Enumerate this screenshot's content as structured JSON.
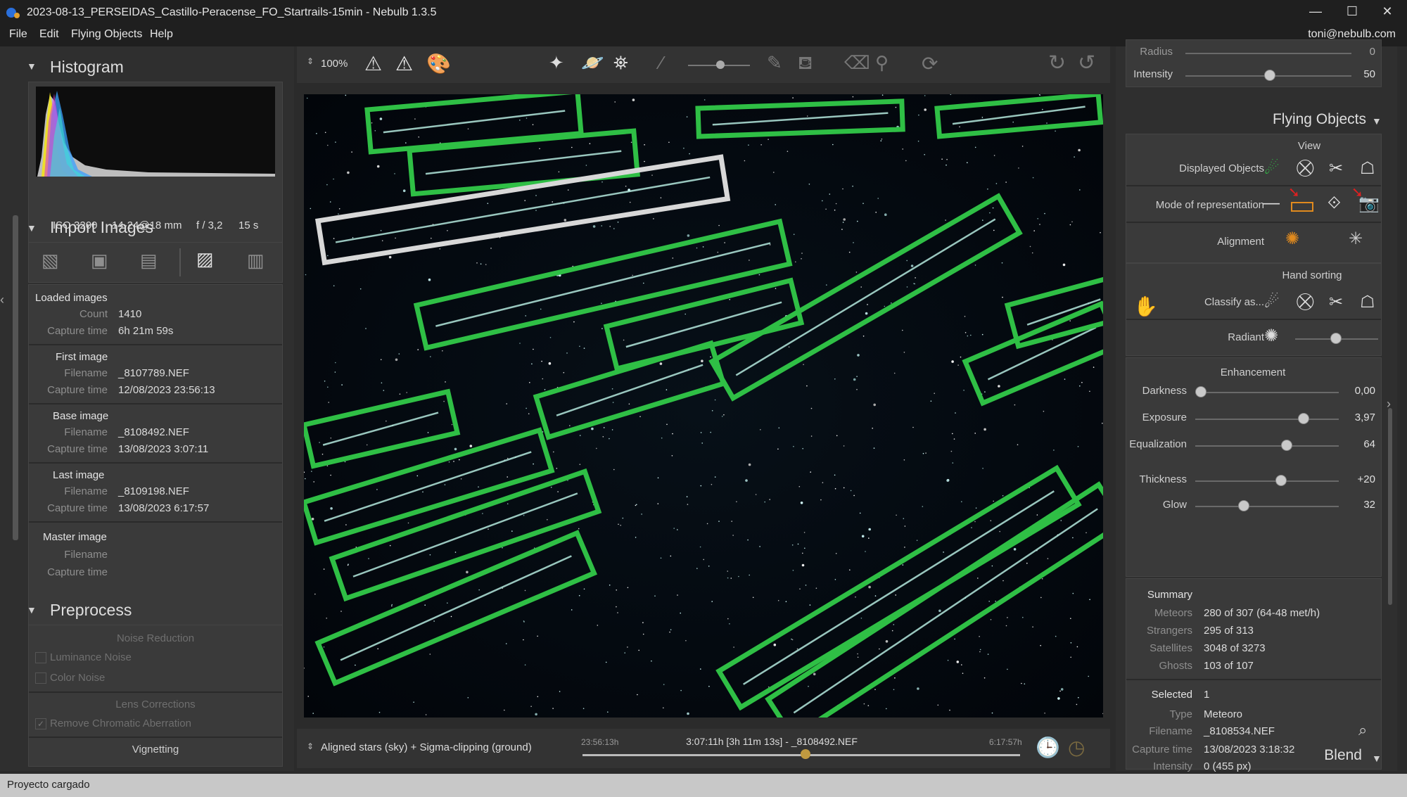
{
  "window": {
    "title": "2023-08-13_PERSEIDAS_Castillo-Peracense_FO_Startrails-15min - Nebulb 1.3.5",
    "min": "—",
    "max": "☐",
    "close": "✕"
  },
  "menu": {
    "file": "File",
    "edit": "Edit",
    "flying_objects": "Flying Objects",
    "help": "Help",
    "user": "toni@nebulb.com"
  },
  "histogram": {
    "header": "Histogram",
    "iso": "ISO 3200",
    "lens": "14-24@18 mm",
    "aperture": "f / 3,2",
    "exposure": "15 s"
  },
  "import": {
    "header": "Import Images",
    "loaded": {
      "title": "Loaded images",
      "count_label": "Count",
      "count": "1410",
      "capture_label": "Capture time",
      "capture": "6h 21m 59s"
    },
    "first": {
      "title": "First image",
      "filename_label": "Filename",
      "filename": "_8107789.NEF",
      "capture_label": "Capture time",
      "capture": "12/08/2023 23:56:13"
    },
    "base": {
      "title": "Base image",
      "filename_label": "Filename",
      "filename": "_8108492.NEF",
      "capture_label": "Capture time",
      "capture": "13/08/2023 3:07:11"
    },
    "last": {
      "title": "Last image",
      "filename_label": "Filename",
      "filename": "_8109198.NEF",
      "capture_label": "Capture time",
      "capture": "13/08/2023 6:17:57"
    },
    "master": {
      "title": "Master image",
      "filename_label": "Filename",
      "capture_label": "Capture time"
    }
  },
  "preprocess": {
    "header": "Preprocess",
    "noise_title": "Noise Reduction",
    "luminance": "Luminance Noise",
    "color": "Color Noise",
    "lens_title": "Lens Corrections",
    "chromatic": "Remove Chromatic Aberration",
    "vignetting": "Vignetting"
  },
  "toolbar": {
    "zoom": "100%"
  },
  "bottom": {
    "mode": "Aligned stars (sky) + Sigma-clipping (ground)",
    "start": "23:56:13h",
    "center": "3:07:11h [3h 11m 13s] - _8108492.NEF",
    "end": "6:17:57h",
    "position": 0.51
  },
  "right": {
    "top": {
      "radius_label": "Radius",
      "radius_value": "0",
      "intensity_label": "Intensity",
      "intensity_value": "50"
    },
    "section": "Flying Objects",
    "view_title": "View",
    "displayed": "Displayed Objects",
    "mode": "Mode of representation",
    "alignment": "Alignment",
    "hand_title": "Hand sorting",
    "classify": "Classify as...",
    "radiant": "Radiant",
    "enh_title": "Enhancement",
    "sliders": [
      {
        "label": "Darkness",
        "value": "0,00",
        "pos": 0.0
      },
      {
        "label": "Exposure",
        "value": "3,97",
        "pos": 0.77
      },
      {
        "label": "Equalization",
        "value": "64",
        "pos": 0.64
      },
      {
        "label": "Thickness",
        "value": "+20",
        "pos": 0.6
      },
      {
        "label": "Glow",
        "value": "32",
        "pos": 0.32
      }
    ],
    "summary": {
      "title": "Summary",
      "meteors_label": "Meteors",
      "meteors": "280 of 307 (64-48 met/h)",
      "strangers_label": "Strangers",
      "strangers": "295 of 313",
      "satellites_label": "Satellites",
      "satellites": "3048 of 3273",
      "ghosts_label": "Ghosts",
      "ghosts": "103 of 107"
    },
    "selected": {
      "title": "Selected",
      "count": "1",
      "type_label": "Type",
      "type": "Meteoro",
      "filename_label": "Filename",
      "filename": "_8108534.NEF",
      "capture_label": "Capture time",
      "capture": "13/08/2023 3:18:32",
      "intensity_label": "Intensity",
      "intensity": "0 (455 px)"
    },
    "blend": "Blend"
  },
  "status": "Proyecto cargado",
  "colors": {
    "accent_green": "#2fbf45",
    "selection_white": "#d8d8d8",
    "orange": "#e08a1e"
  }
}
